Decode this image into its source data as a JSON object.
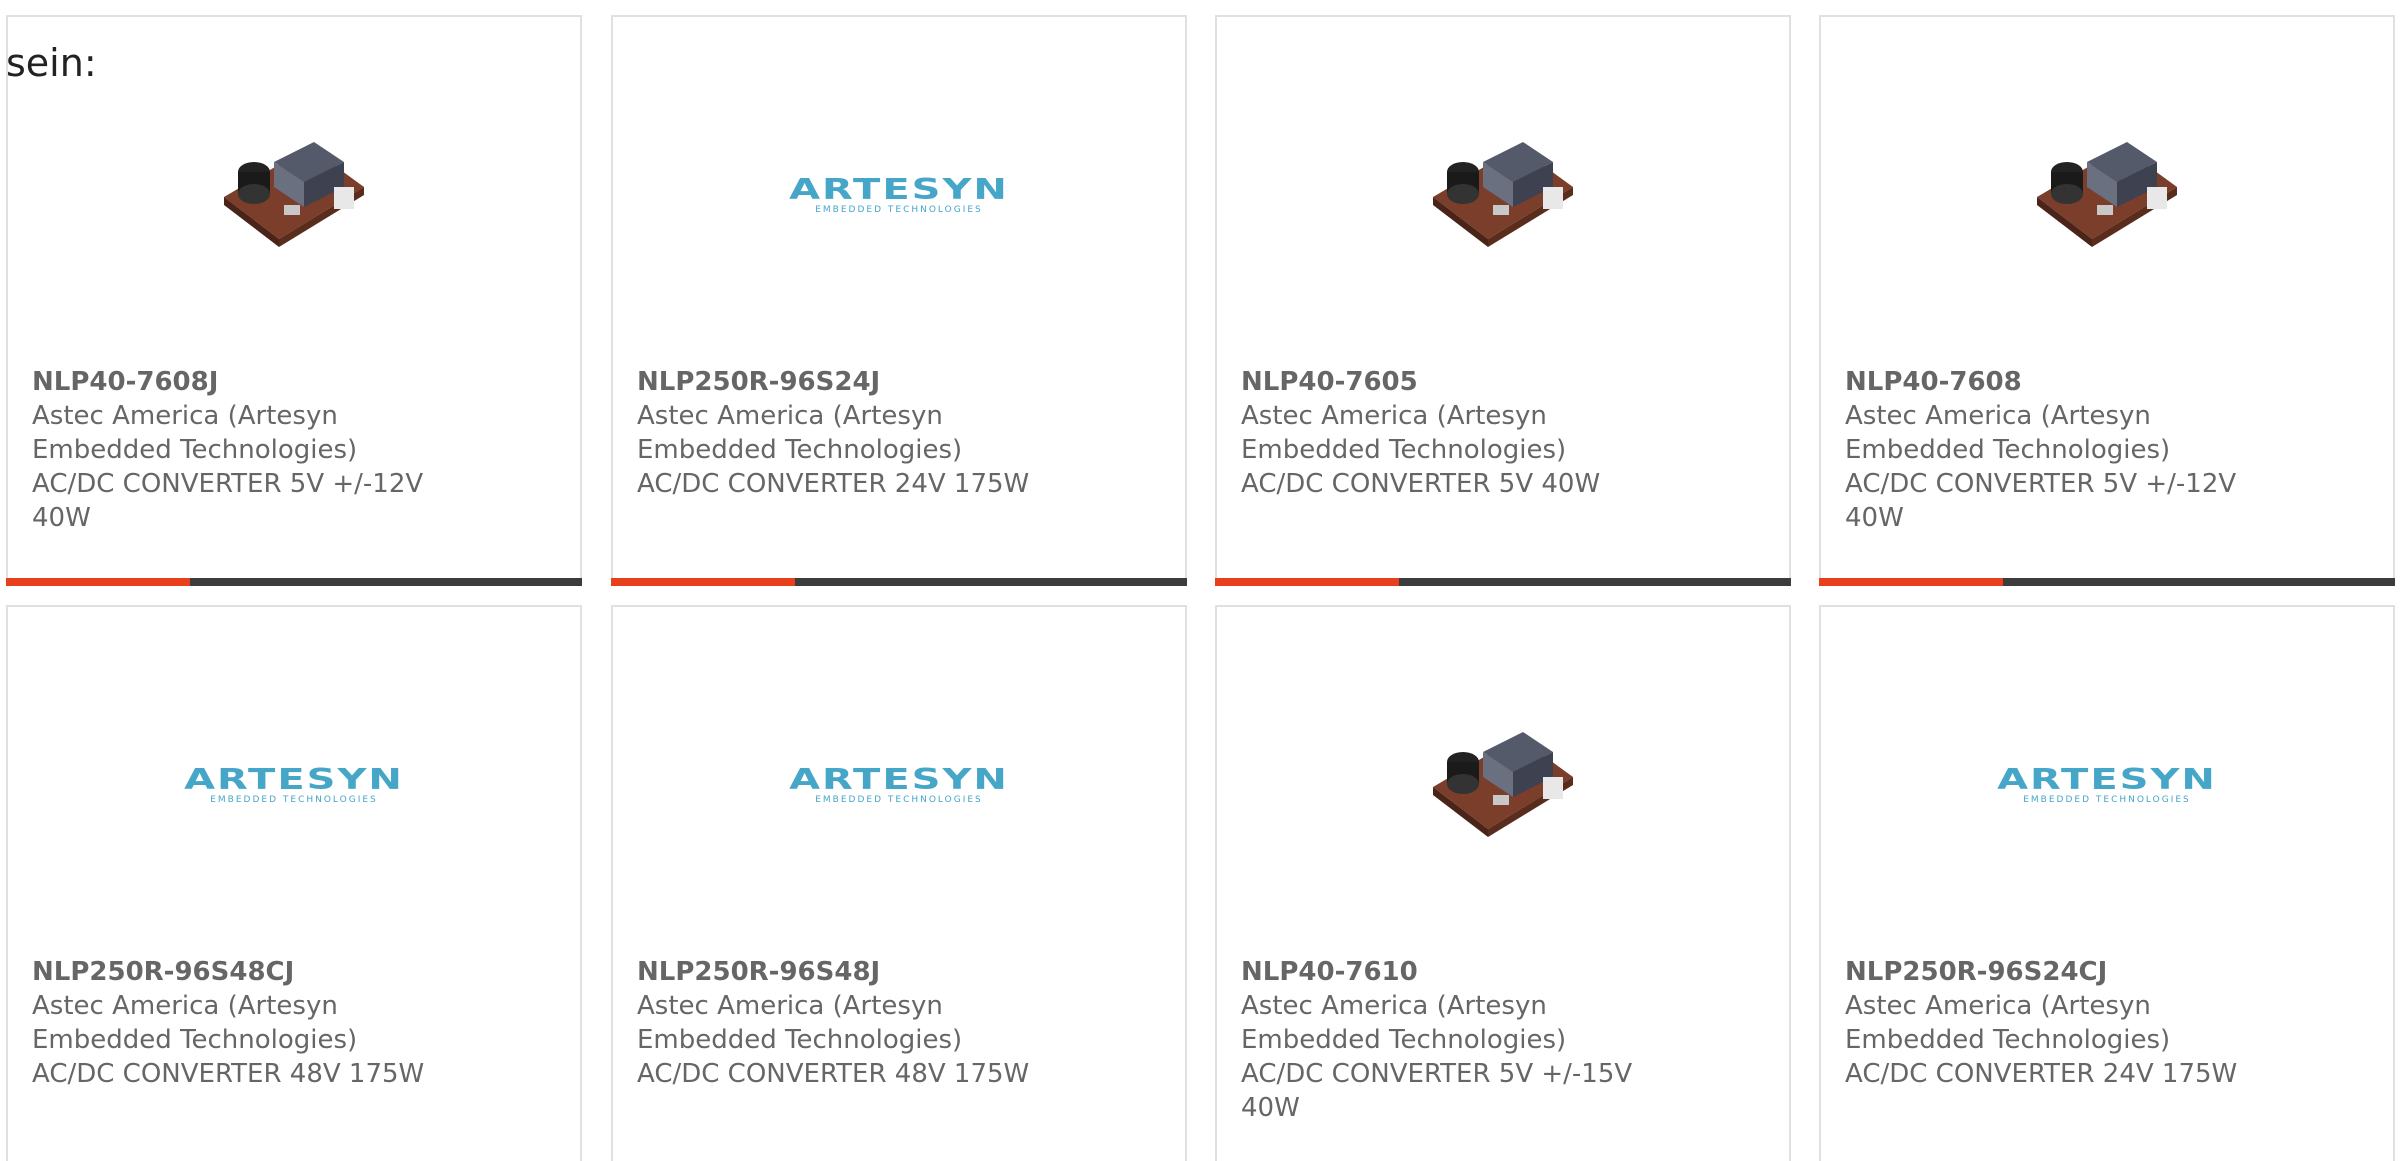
{
  "intro_text": "sein:",
  "logo": {
    "brand": "ARTESYN",
    "tagline": "EMBEDDED TECHNOLOGIES"
  },
  "colors": {
    "accent": "#e8401c",
    "bar": "#3c3c3c",
    "logo": "#45a6c8"
  },
  "products": [
    {
      "part": "NLP40-7608J",
      "manufacturer": "Astec America (Artesyn Embedded Technologies)",
      "description": "AC/DC CONVERTER 5V +/-12V 40W",
      "image": "power-supply-board"
    },
    {
      "part": "NLP250R-96S24J",
      "manufacturer": "Astec America (Artesyn Embedded Technologies)",
      "description": "AC/DC CONVERTER 24V 175W",
      "image": "artesyn-logo"
    },
    {
      "part": "NLP40-7605",
      "manufacturer": "Astec America (Artesyn Embedded Technologies)",
      "description": "AC/DC CONVERTER 5V 40W",
      "image": "power-supply-board"
    },
    {
      "part": "NLP40-7608",
      "manufacturer": "Astec America (Artesyn Embedded Technologies)",
      "description": "AC/DC CONVERTER 5V +/-12V 40W",
      "image": "power-supply-board"
    },
    {
      "part": "NLP250R-96S48CJ",
      "manufacturer": "Astec America (Artesyn Embedded Technologies)",
      "description": "AC/DC CONVERTER 48V 175W",
      "image": "artesyn-logo"
    },
    {
      "part": "NLP250R-96S48J",
      "manufacturer": "Astec America (Artesyn Embedded Technologies)",
      "description": "AC/DC CONVERTER 48V 175W",
      "image": "artesyn-logo"
    },
    {
      "part": "NLP40-7610",
      "manufacturer": "Astec America (Artesyn Embedded Technologies)",
      "description": "AC/DC CONVERTER 5V +/-15V 40W",
      "image": "power-supply-board"
    },
    {
      "part": "NLP250R-96S24CJ",
      "manufacturer": "Astec America (Artesyn Embedded Technologies)",
      "description": "AC/DC CONVERTER 24V 175W",
      "image": "artesyn-logo"
    }
  ]
}
